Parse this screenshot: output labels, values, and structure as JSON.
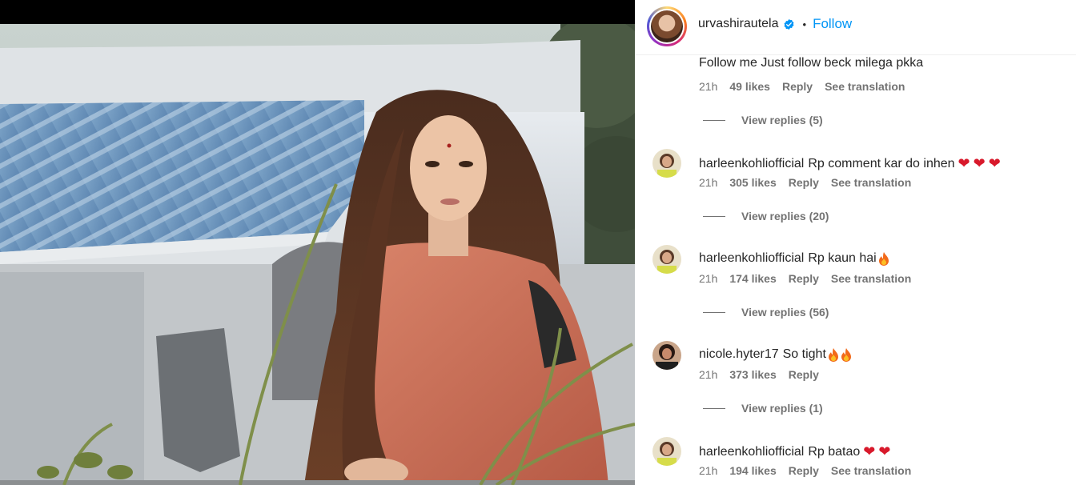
{
  "post": {
    "author": "urvashirautela",
    "verified": true,
    "separator": "•",
    "follow_label": "Follow"
  },
  "first_comment": {
    "text": "Follow me Just follow beck milega pkka",
    "time": "21h",
    "likes": "49 likes",
    "reply_label": "Reply",
    "translation_label": "See translation",
    "view_replies": "View replies (5)"
  },
  "comments": [
    {
      "user": "harleenkohliofficial",
      "text": "Rp comment kar do inhen",
      "emojis": [
        "heart",
        "heart",
        "heart"
      ],
      "time": "21h",
      "likes": "305 likes",
      "reply_label": "Reply",
      "translation_label": "See translation",
      "view_replies": "View replies (20)"
    },
    {
      "user": "harleenkohliofficial",
      "text": "Rp kaun hai",
      "emojis": [
        "fire"
      ],
      "time": "21h",
      "likes": "174 likes",
      "reply_label": "Reply",
      "translation_label": "See translation",
      "view_replies": "View replies (56)"
    },
    {
      "user": "nicole.hyter17",
      "text": "So tight",
      "emojis": [
        "fire",
        "fire"
      ],
      "time": "21h",
      "likes": "373 likes",
      "reply_label": "Reply",
      "translation_label": "",
      "view_replies": "View replies (1)"
    },
    {
      "user": "harleenkohliofficial",
      "text": "Rp batao",
      "emojis": [
        "heart",
        "heart"
      ],
      "time": "21h",
      "likes": "194 likes",
      "reply_label": "Reply",
      "translation_label": "See translation",
      "view_replies": ""
    }
  ],
  "icons": {
    "verified": "verified-badge-icon",
    "heart": "red-heart-emoji",
    "fire": "fire-emoji"
  },
  "colors": {
    "link_blue": "#0095f6",
    "verified_blue": "#0095f6",
    "text_primary": "#262626",
    "text_secondary": "#737373",
    "heart_red": "#d8192b"
  }
}
